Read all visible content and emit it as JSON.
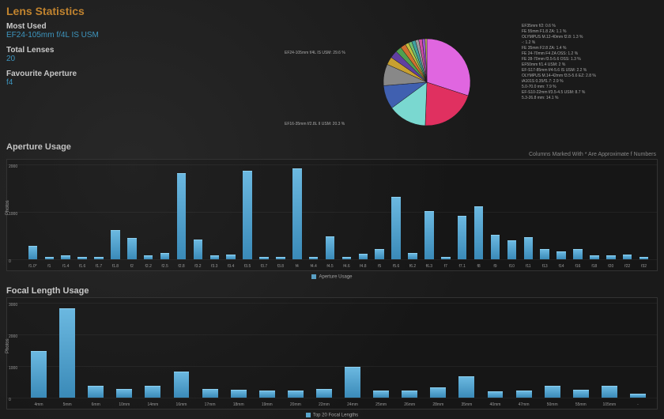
{
  "header": "Lens Statistics",
  "stats": {
    "most_used_label": "Most Used",
    "most_used_value": "EF24-105mm f/4L IS USM",
    "total_label": "Total Lenses",
    "total_value": "20",
    "fav_ap_label": "Favourite Aperture",
    "fav_ap_value": "f4"
  },
  "note": "Columns Marked With * Are Approximate f Numbers",
  "section_aperture": "Aperture Usage",
  "section_focal": "Focal Length Usage",
  "aperture_legend": "Aperture Usage",
  "focal_legend": "Top 20 Focal Lengths",
  "ytitle": "Photos",
  "chart_data": [
    {
      "type": "pie",
      "title": "Lens usage share",
      "series": [
        {
          "name": "EF24-105mm f/4L IS USM",
          "value": 29.6,
          "color": "#e066e0"
        },
        {
          "name": "EF16-35mm f/2.8L II USM",
          "value": 20.3,
          "color": "#e03060"
        },
        {
          "name": "5.3-26.8 mm",
          "value": 14.1,
          "color": "#7ad8d0"
        },
        {
          "name": "EF-S10-22mm f/3.5-4.5 USM",
          "value": 8.7,
          "color": "#4060b0"
        },
        {
          "name": "5.0-70.0 mm",
          "value": 7.9,
          "color": "#888"
        },
        {
          "name": "iA101S 0.35/f1.7",
          "value": 2.9,
          "color": "#c8a030"
        },
        {
          "name": "OLYMPUS M.14-42mm f3.5-5.6 EZ",
          "value": 2.8,
          "color": "#6040a0"
        },
        {
          "name": "EF-S17-85mm f/4-5.6 IS USM",
          "value": 2.2,
          "color": "#50a050"
        },
        {
          "name": "EF50mm f/1.4 USM",
          "value": 2.0,
          "color": "#d07030"
        },
        {
          "name": "FE 28-70mm f3.5-5.6 OSS",
          "value": 1.3,
          "color": "#c0c040"
        },
        {
          "name": "FE 24-70mm F4 ZA OSS",
          "value": 1.2,
          "color": "#70c070"
        },
        {
          "name": "FE 35mm F2.8 ZA",
          "value": 1.4,
          "color": "#40a0a0"
        },
        {
          "name": "-",
          "value": 1.2,
          "color": "#a0a0a0"
        },
        {
          "name": "OLYMPUS M.12-40mm f2.8",
          "value": 1.3,
          "color": "#d050a0"
        },
        {
          "name": "FE 55mm F1.8 ZA",
          "value": 1.1,
          "color": "#a050d0"
        },
        {
          "name": "EF35mm f/2",
          "value": 0.6,
          "color": "#d0d060"
        }
      ]
    },
    {
      "type": "bar",
      "title": "Aperture Usage",
      "ylabel": "Photos",
      "ylim": [
        0,
        2000
      ],
      "yticks": [
        0,
        1000,
        2000
      ],
      "categories": [
        "f1.0*",
        "f1",
        "f1.4",
        "f1.6",
        "f1.7",
        "f1.8",
        "f2",
        "f2.2",
        "f2.5",
        "f2.8",
        "f3.2",
        "f3.3",
        "f3.4",
        "f3.5",
        "f3.7",
        "f3.8",
        "f4",
        "f4.4",
        "f4.5",
        "f4.6",
        "f4.8",
        "f5",
        "f5.6",
        "f6.2",
        "f6.3",
        "f7",
        "f7.1",
        "f8",
        "f9",
        "f10",
        "f11",
        "f13",
        "f14",
        "f16",
        "f18",
        "f20",
        "f22",
        "f32"
      ],
      "values": [
        260,
        40,
        60,
        30,
        40,
        600,
        430,
        70,
        120,
        1800,
        400,
        60,
        80,
        1850,
        30,
        30,
        1900,
        30,
        470,
        30,
        100,
        200,
        1300,
        120,
        1000,
        30,
        900,
        1100,
        500,
        380,
        450,
        200,
        150,
        200,
        60,
        60,
        80,
        30
      ]
    },
    {
      "type": "bar",
      "title": "Top 20 Focal Lengths",
      "ylabel": "Photos",
      "ylim": [
        0,
        3000
      ],
      "yticks": [
        0,
        1000,
        2000,
        3000
      ],
      "categories": [
        "4mm",
        "5mm",
        "6mm",
        "10mm",
        "14mm",
        "16mm",
        "17mm",
        "18mm",
        "19mm",
        "20mm",
        "22mm",
        "24mm",
        "25mm",
        "26mm",
        "28mm",
        "35mm",
        "40mm",
        "47mm",
        "50mm",
        "55mm",
        "105mm",
        "-"
      ],
      "values": [
        1450,
        2800,
        350,
        230,
        350,
        800,
        240,
        220,
        180,
        200,
        240,
        950,
        180,
        200,
        280,
        650,
        160,
        200,
        350,
        220,
        340,
        90
      ]
    }
  ]
}
